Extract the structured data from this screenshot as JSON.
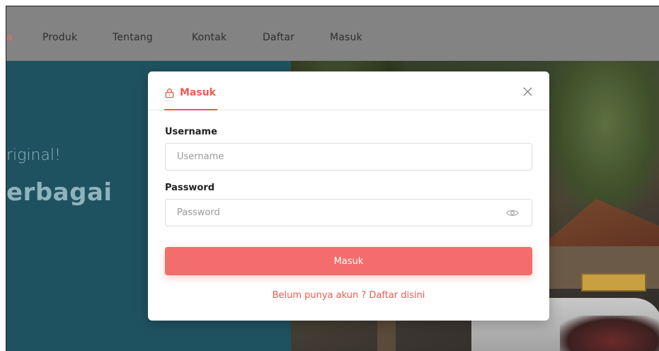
{
  "navbar": {
    "items": [
      {
        "label": "a"
      },
      {
        "label": "Produk"
      },
      {
        "label": "Tentang"
      },
      {
        "label": "Kontak"
      },
      {
        "label": "Daftar"
      },
      {
        "label": "Masuk"
      }
    ]
  },
  "hero": {
    "subtitle": "riginal!",
    "title": "erbagai"
  },
  "modal": {
    "tab_label": "Masuk",
    "tab_icon": "lock-icon",
    "close_icon": "close-icon",
    "username": {
      "label": "Username",
      "placeholder": "Username",
      "value": ""
    },
    "password": {
      "label": "Password",
      "placeholder": "Password",
      "value": "",
      "toggle_icon": "eye-icon"
    },
    "submit_label": "Masuk",
    "register_link": "Belum punya akun ? Daftar disini"
  },
  "colors": {
    "accent": "#ee5a52",
    "button": "#f26d6b",
    "hero_left": "#1f5260",
    "navbar": "#838383"
  }
}
